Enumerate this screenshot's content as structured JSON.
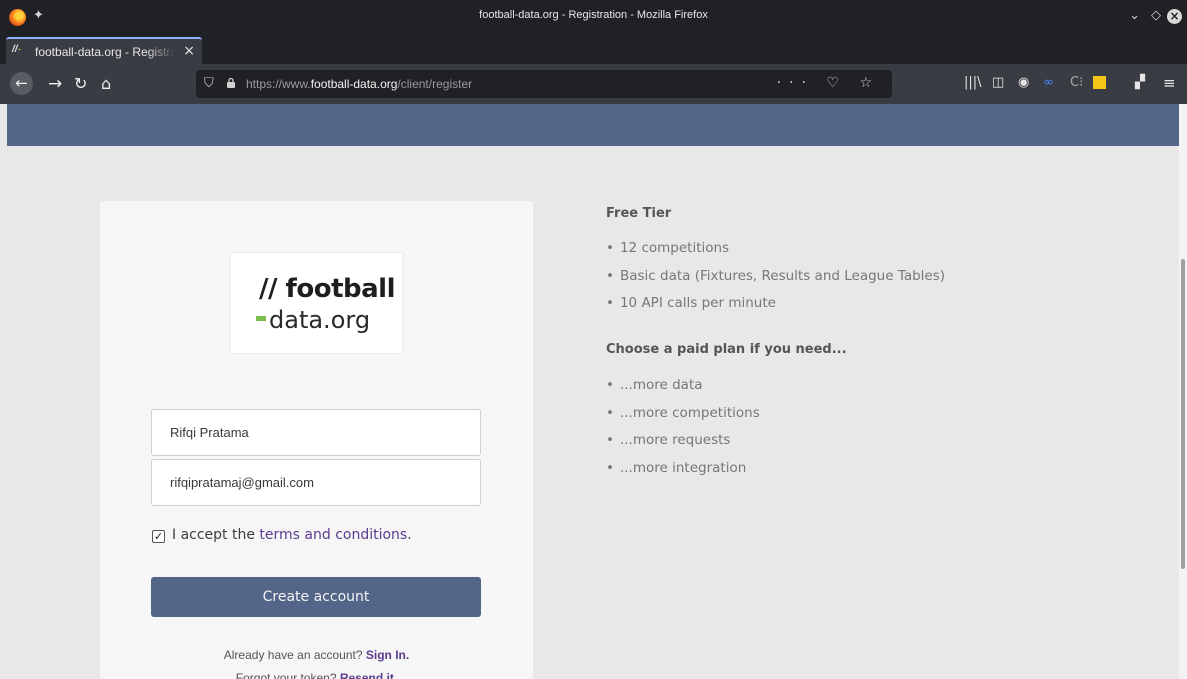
{
  "window": {
    "title": "football-data.org - Registration - Mozilla Firefox",
    "buttons": [
      "minimize-icon",
      "maximize-icon",
      "close-icon"
    ]
  },
  "tab": {
    "favicon_text": "//-",
    "label": "football-data.org - Registration",
    "close": "×"
  },
  "nav": {
    "url_prefix": "https://www.",
    "url_domain": "football-data.org",
    "url_path": "/client/register",
    "page_actions": "··· ♡ ☆"
  },
  "card": {
    "logo_line1": "// football",
    "logo_line2": "data.org",
    "name_value": "Rifqi Pratama",
    "email_value": "rifqipratamaj@gmail.com",
    "accept_prefix": "I accept the ",
    "terms_link": "terms and conditions",
    "accept_suffix": ".",
    "create_label": "Create account",
    "already_text": "Already have an account? ",
    "sign_in": "Sign In.",
    "forgot_text": "Forgot your token? ",
    "resend": "Resend it."
  },
  "info": {
    "free_title": "Free Tier",
    "free_items": [
      "12 competitions",
      "Basic data (Fixtures, Results and League Tables)",
      "10 API calls per minute"
    ],
    "paid_title": "Choose a paid plan if you need...",
    "paid_items": [
      "...more data",
      "...more competitions",
      "...more requests",
      "...more integration"
    ]
  },
  "colors": {
    "header_band": "#536689",
    "button": "#536689",
    "link": "#5a3d8e",
    "logo_accent": "#7cbf4b"
  }
}
